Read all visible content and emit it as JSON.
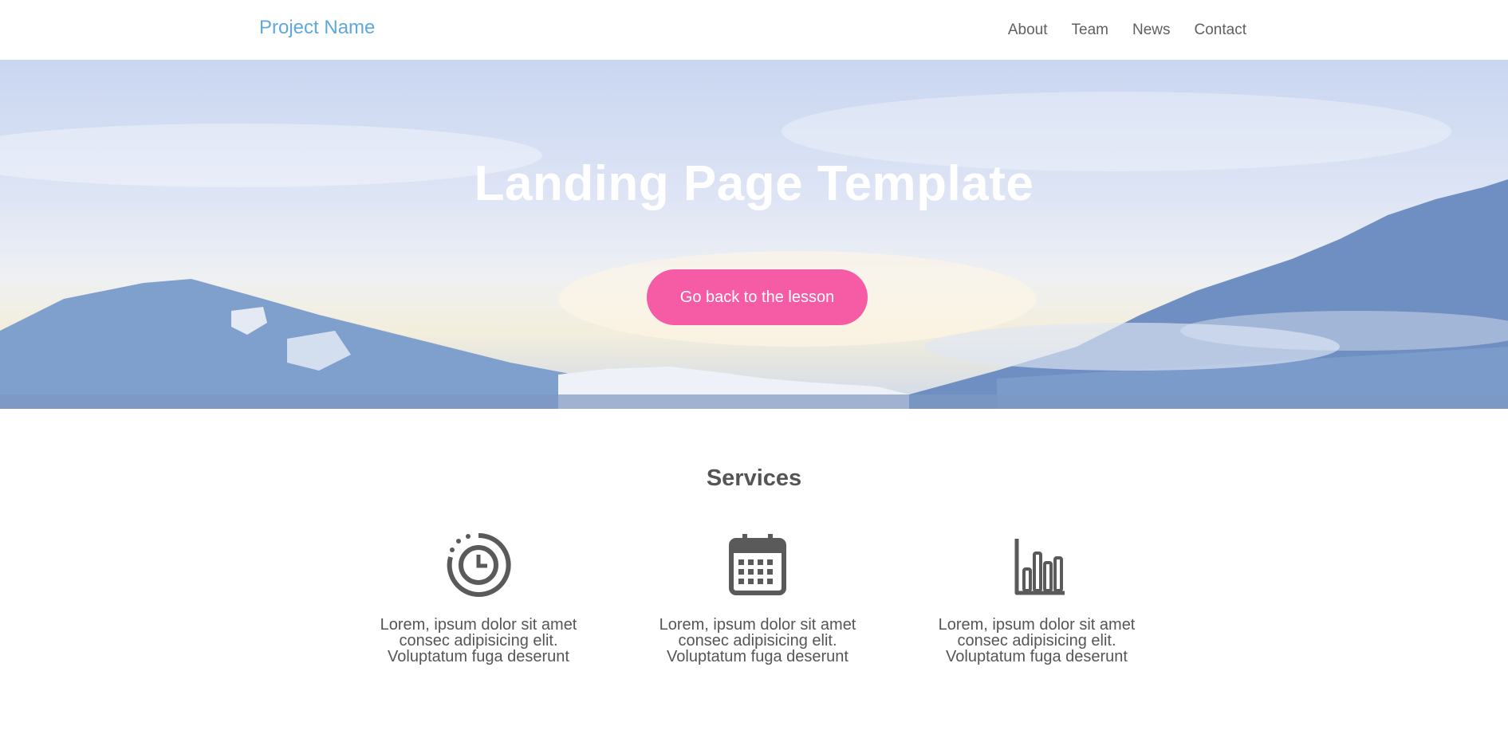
{
  "navbar": {
    "brand": "Project Name",
    "links": [
      "About",
      "Team",
      "News",
      "Contact"
    ]
  },
  "hero": {
    "title": "Landing Page Template",
    "button_label": "Go back to the lesson"
  },
  "services": {
    "title": "Services",
    "items": [
      {
        "icon": "clock-icon",
        "lines": [
          "Lorem, ipsum dolor sit amet",
          "consec adipisicing elit.",
          "Voluptatum fuga deserunt"
        ]
      },
      {
        "icon": "calendar-icon",
        "lines": [
          "Lorem, ipsum dolor sit amet",
          "consec adipisicing elit.",
          "Voluptatum fuga deserunt"
        ]
      },
      {
        "icon": "bar-chart-icon",
        "lines": [
          "Lorem, ipsum dolor sit amet",
          "consec adipisicing elit.",
          "Voluptatum fuga deserunt"
        ]
      }
    ]
  },
  "colors": {
    "brand": "#5ea9d9",
    "accent_button": "#f65ca6",
    "text": "#555555",
    "icon": "#5a5a5a"
  }
}
